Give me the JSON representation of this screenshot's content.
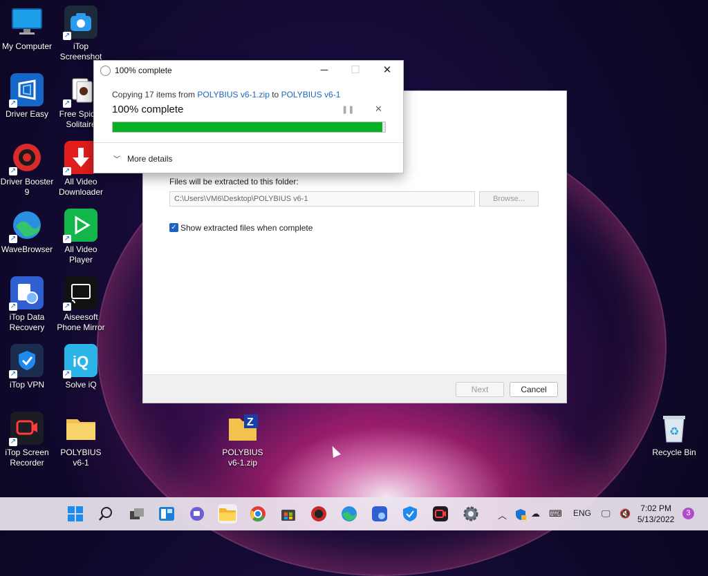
{
  "desktop": {
    "icons": [
      {
        "label": "My Computer"
      },
      {
        "label": "iTop Screenshot"
      },
      {
        "label": "Driver Easy"
      },
      {
        "label": "Free Spider Solitaire"
      },
      {
        "label": "Driver Booster 9"
      },
      {
        "label": "All Video Downloader"
      },
      {
        "label": "WaveBrowser"
      },
      {
        "label": "All Video Player"
      },
      {
        "label": "iTop Data Recovery"
      },
      {
        "label": "Aiseesoft Phone Mirror"
      },
      {
        "label": "iTop VPN"
      },
      {
        "label": "Solve iQ"
      },
      {
        "label": "iTop Screen Recorder"
      },
      {
        "label": "POLYBIUS v6-1"
      },
      {
        "label": "POLYBIUS v6-1.zip"
      },
      {
        "label": "Recycle Bin"
      }
    ]
  },
  "extract_window": {
    "folder_label": "Files will be extracted to this folder:",
    "folder_path": "C:\\Users\\VM6\\Desktop\\POLYBIUS v6-1",
    "browse_label": "Browse...",
    "show_files_label": "Show extracted files when complete",
    "show_files_checked": true,
    "next_label": "Next",
    "cancel_label": "Cancel"
  },
  "progress_dialog": {
    "title": "100% complete",
    "copying_prefix": "Copying 17 items from ",
    "source": "POLYBIUS v6-1.zip",
    "copying_to": " to ",
    "destination": "POLYBIUS v6-1",
    "percent_text": "100% complete",
    "progress": 0.99,
    "more_details_label": "More details",
    "minimize_glyph": "─",
    "maximize_glyph": "☐",
    "close_glyph": "✕"
  },
  "taskbar": {
    "language": "ENG",
    "time": "7:02 PM",
    "date": "5/13/2022",
    "notification_count": "3"
  }
}
